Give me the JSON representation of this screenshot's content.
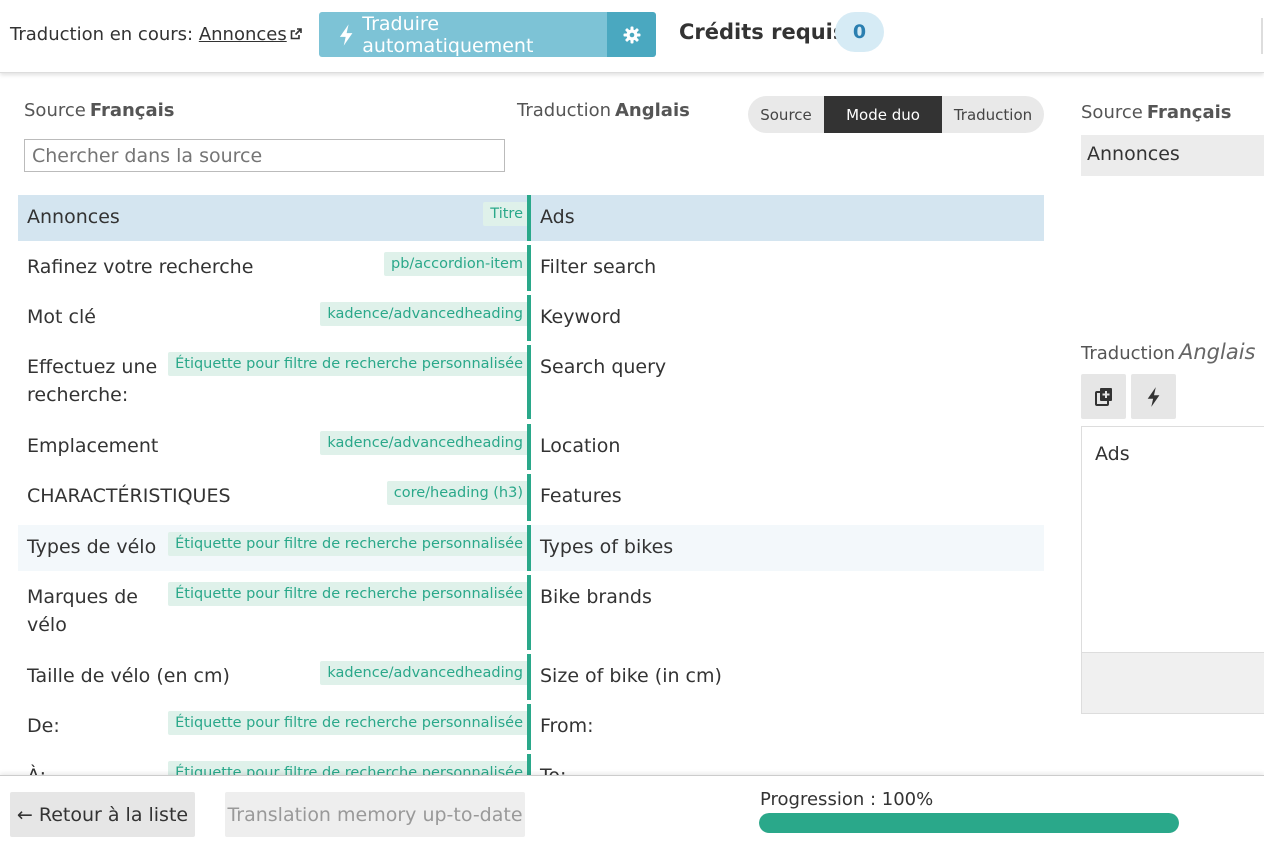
{
  "topbar": {
    "current_label": "Traduction en cours:",
    "current_link": "Annonces",
    "auto_translate_label": "Traduire automatiquement",
    "credits_label": "Crédits requis",
    "credits_value": "0"
  },
  "left": {
    "source_label": "Source",
    "source_lang": "Français",
    "translation_label": "Traduction",
    "translation_lang": "Anglais",
    "search_placeholder": "Chercher dans la source"
  },
  "mode_toggle": {
    "source": "Source",
    "duo": "Mode duo",
    "translation": "Traduction"
  },
  "rows": [
    {
      "source": "Annonces",
      "tag": "Titre",
      "translation": "Ads"
    },
    {
      "source": "Rafinez votre recherche",
      "tag": "pb/accordion-item",
      "translation": "Filter search"
    },
    {
      "source": "Mot clé",
      "tag": "kadence/advancedheading",
      "translation": "Keyword"
    },
    {
      "source": "Effectuez une recherche:",
      "tag": "Étiquette pour filtre de recherche personnalisée",
      "translation": "Search query"
    },
    {
      "source": "Emplacement",
      "tag": "kadence/advancedheading",
      "translation": "Location"
    },
    {
      "source": "CHARACTÉRISTIQUES",
      "tag": "core/heading (h3)",
      "translation": "Features"
    },
    {
      "source": "Types de vélo",
      "tag": "Étiquette pour filtre de recherche personnalisée",
      "translation": "Types of bikes"
    },
    {
      "source": "Marques de vélo",
      "tag": "Étiquette pour filtre de recherche personnalisée",
      "translation": "Bike brands"
    },
    {
      "source": "Taille de vélo (en cm)",
      "tag": "kadence/advancedheading",
      "translation": "Size of bike (in cm)"
    },
    {
      "source": "De:",
      "tag": "Étiquette pour filtre de recherche personnalisée",
      "translation": "From:"
    },
    {
      "source": "À:",
      "tag": "Étiquette pour filtre de recherche personnalisée",
      "translation": "To:"
    }
  ],
  "right": {
    "source_label": "Source",
    "source_lang": "Français",
    "source_text": "Annonces",
    "translation_label": "Traduction",
    "translation_lang": "Anglais",
    "translation_text": "Ads"
  },
  "footer": {
    "back_label": "← Retour à la liste",
    "tm_label": "Translation memory up-to-date",
    "progress_label": "Progression : 100%",
    "progress_fraction": 1.0
  },
  "colors": {
    "accent_green": "#2aa88a",
    "auto_button": "#7dc3d6",
    "gear_button": "#4aa8c0",
    "selected_row": "#d4e5f0"
  }
}
